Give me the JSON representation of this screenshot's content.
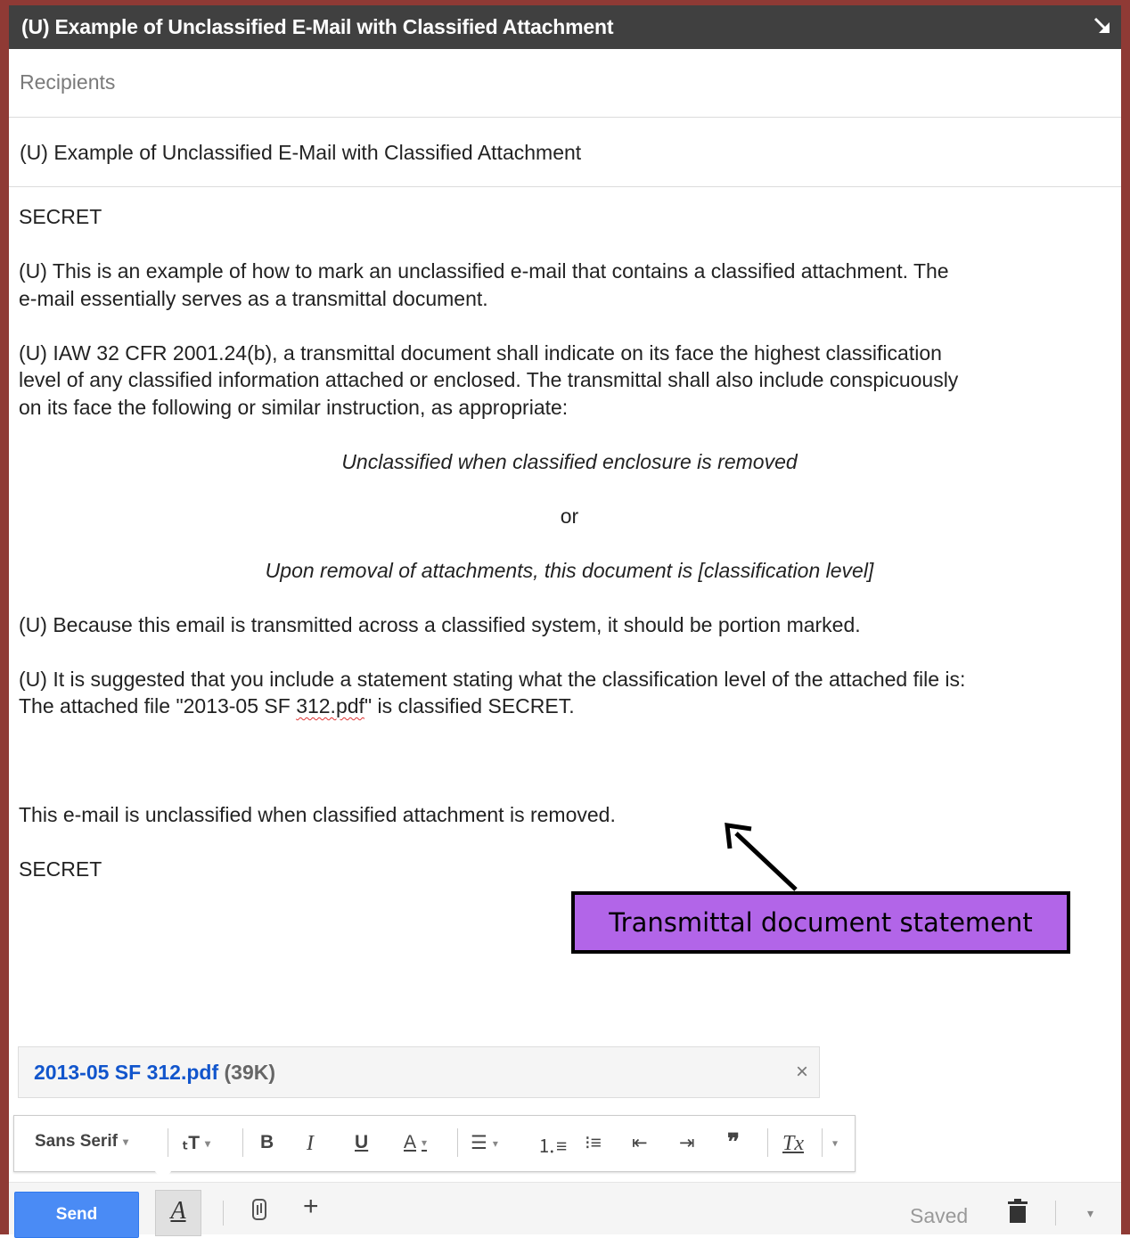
{
  "window": {
    "title": "(U) Example of Unclassified E-Mail with Classified Attachment",
    "expand_icon": "expand-arrow-icon"
  },
  "recipients": {
    "placeholder": "Recipients"
  },
  "subject": {
    "value": "(U) Example of Unclassified E-Mail with Classified Attachment"
  },
  "body": {
    "header_marking": "SECRET",
    "para1_line1": "(U) This is an example of how to mark an unclassified e-mail that contains a classified attachment.  The",
    "para1_line2": "e-mail essentially serves as a transmittal document.",
    "para2_line1": "(U) IAW 32 CFR 2001.24(b), a transmittal document shall indicate on its face the highest classification",
    "para2_line2": "level of any classified information attached or enclosed. The transmittal shall also include conspicuously",
    "para2_line3": "on its face the following or similar instruction, as appropriate:",
    "instruction1": "Unclassified when classified enclosure is removed",
    "or": "or",
    "instruction2": "Upon removal of attachments, this document is [classification level]",
    "para3": "(U) Because this email is transmitted across a classified system, it should be portion marked.",
    "para4_line1": "(U) It is suggested that you include a statement stating what the classification level of the attached file is:",
    "para4_line2_pre": "The attached file \"2013-05 SF ",
    "para4_line2_misspelled": "312.pdf",
    "para4_line2_post": "\" is classified SECRET.",
    "transmittal_statement": "This e-mail is unclassified when classified attachment is removed.",
    "footer_marking": "SECRET"
  },
  "callout": {
    "text": "Transmittal document statement"
  },
  "attachment": {
    "name": "2013-05 SF 312.pdf",
    "size": "(39K)",
    "close": "×"
  },
  "formatting": {
    "font_family": "Sans Serif",
    "size_icon": "text-size-icon",
    "bold": "B",
    "italic": "I",
    "underline": "U",
    "text_color": "A"
  },
  "bottom": {
    "send_label": "Send",
    "format_toggle": "A",
    "more_label": "+",
    "saved_label": "Saved"
  },
  "colors": {
    "title_bg": "#404040",
    "frame": "#8f3a35",
    "send": "#4a8bf5",
    "callout_bg": "#b265e8",
    "link": "#1155cc"
  }
}
